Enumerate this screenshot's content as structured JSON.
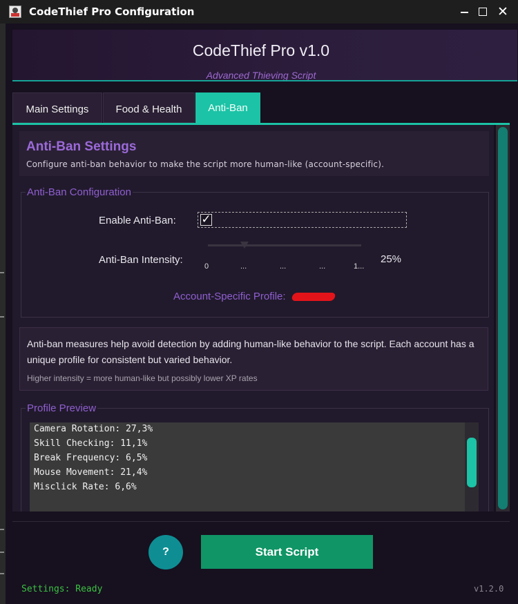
{
  "window": {
    "title": "CodeThief Pro Configuration",
    "icons": {
      "app": "app-icon",
      "minimize": "minimize-icon",
      "maximize": "maximize-icon",
      "close": "close-icon"
    },
    "close_glyph": "✕"
  },
  "header": {
    "title": "CodeThief Pro v1.0",
    "subtitle": "Advanced Thieving Script"
  },
  "tabs": [
    {
      "label": "Main Settings",
      "active": false
    },
    {
      "label": "Food & Health",
      "active": false
    },
    {
      "label": "Anti-Ban",
      "active": true
    }
  ],
  "antiban": {
    "title": "Anti-Ban Settings",
    "description": "Configure anti-ban behavior to make the script more human-like (account-specific).",
    "config": {
      "legend": "Anti-Ban Configuration",
      "enable_label": "Enable Anti-Ban:",
      "enable_checked": true,
      "enable_check_glyph": "✓",
      "intensity_label": "Anti-Ban Intensity:",
      "intensity_value": "25%",
      "intensity_fraction": 0.25,
      "ticks": [
        "0",
        "...",
        "...",
        "...",
        "1..."
      ],
      "profile_label": "Account-Specific Profile:"
    },
    "info": {
      "text": "Anti-ban measures help avoid detection by adding human-like behavior to the script. Each account has a unique profile for consistent but varied behavior.",
      "note": "Higher intensity = more human-like but possibly lower XP rates"
    },
    "preview": {
      "legend": "Profile Preview",
      "lines": [
        "Camera Rotation: 27,3%",
        "Skill Checking: 11,1%",
        "Break Frequency: 6,5%",
        "Mouse Movement: 21,4%",
        "Misclick Rate: 6,6%"
      ]
    }
  },
  "footer": {
    "help_label": "?",
    "start_label": "Start Script",
    "status": "Settings: Ready",
    "version": "v1.2.0"
  },
  "colors": {
    "accent_teal": "#1cc3a6",
    "purple": "#9b6ad8",
    "start_green": "#109566",
    "status_green": "#3bc243"
  }
}
